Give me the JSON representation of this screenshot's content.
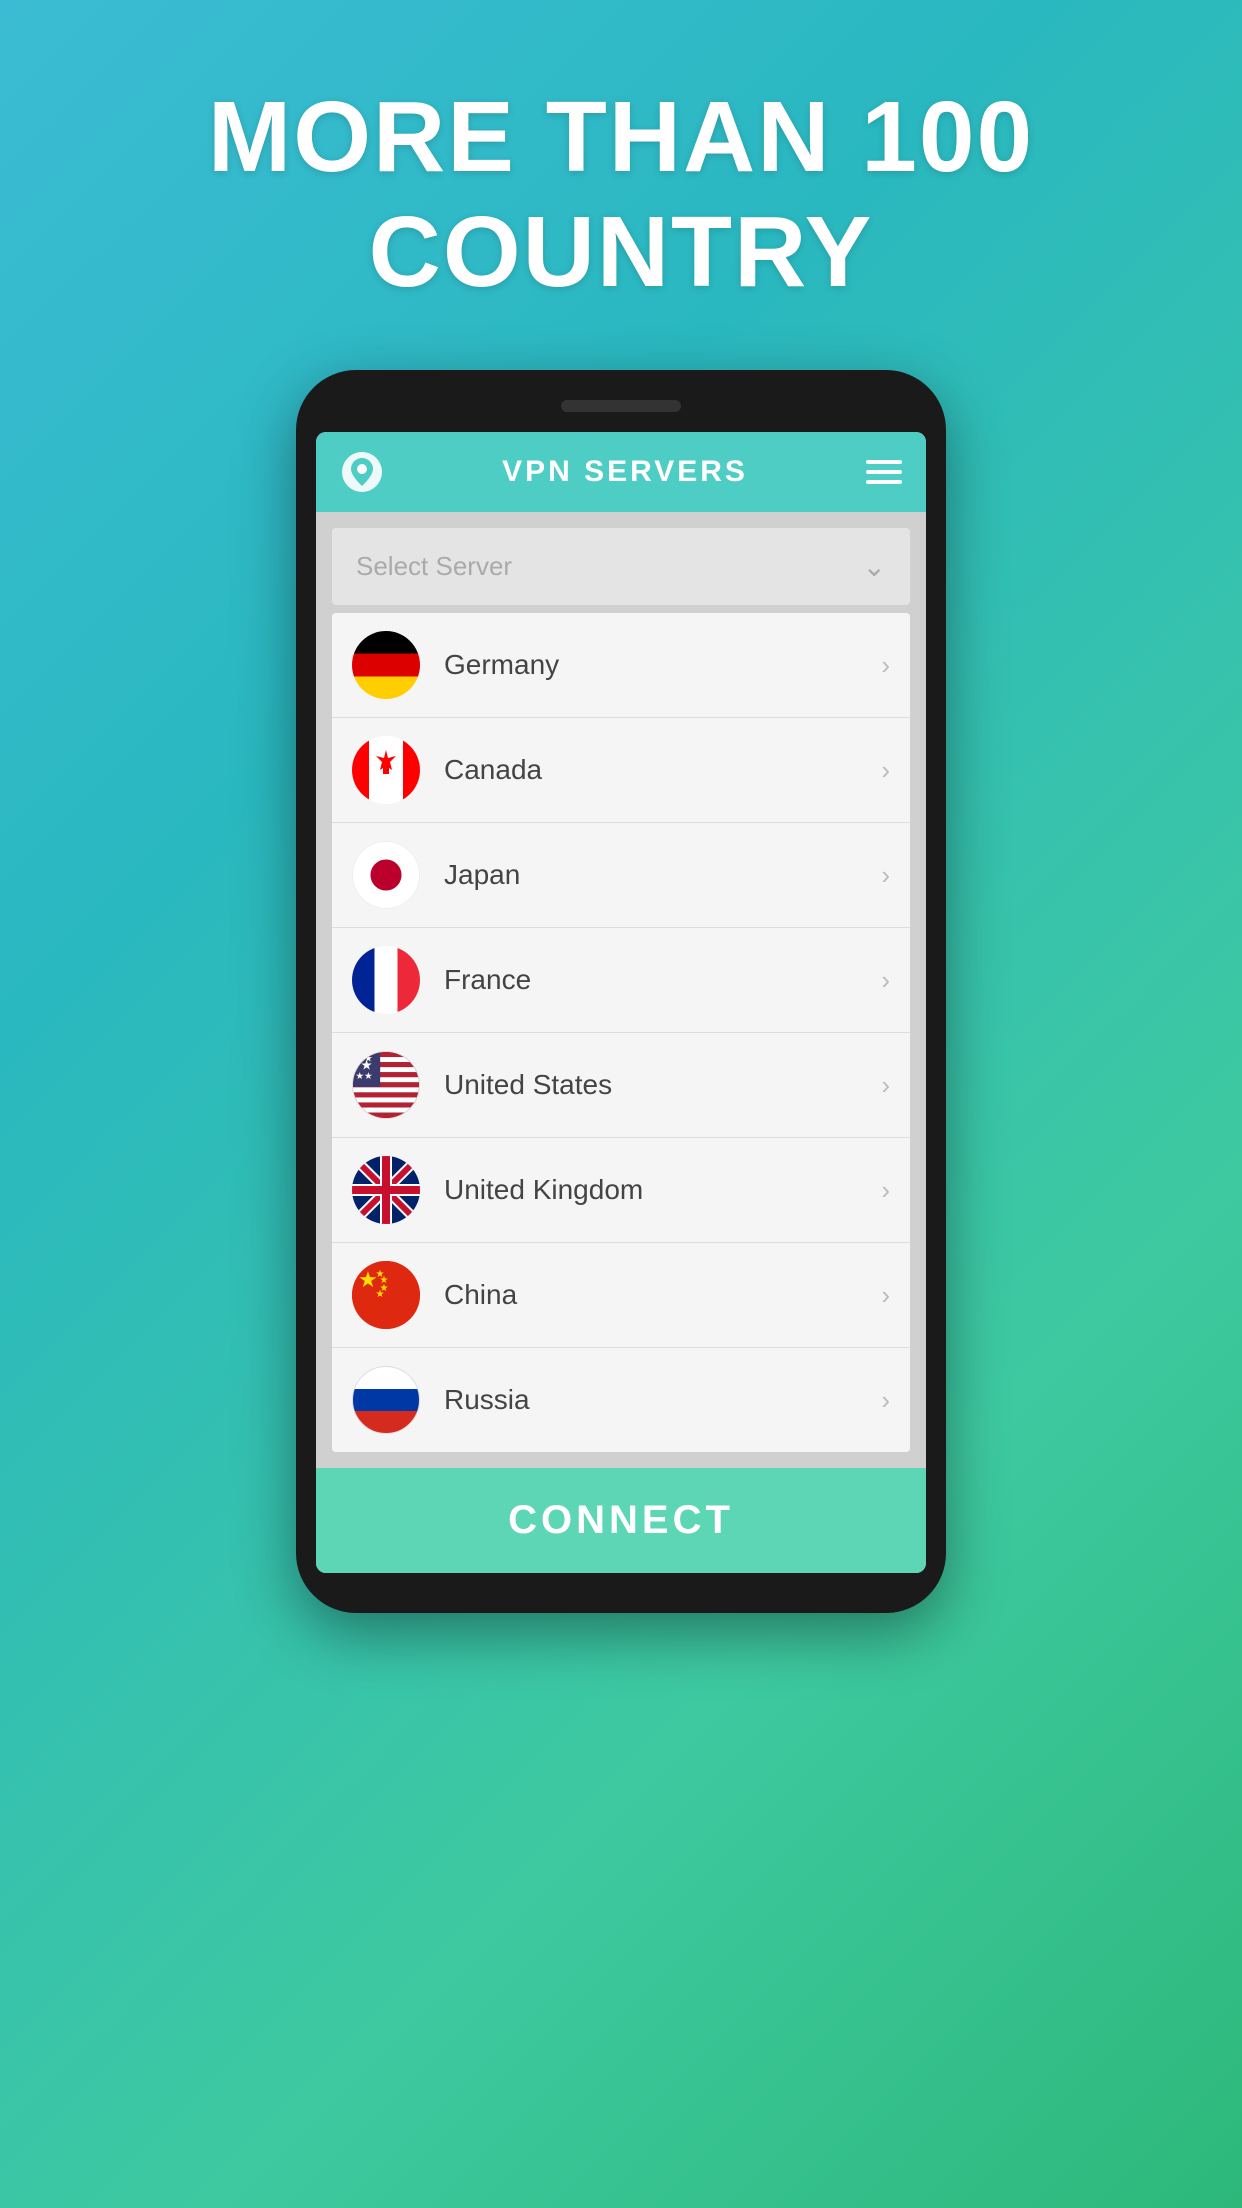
{
  "headline": {
    "line1": "MORE THAN 100",
    "line2": "COUNTRY"
  },
  "header": {
    "title": "VPN SERVERS",
    "icon_name": "location-pin-icon",
    "menu_icon_name": "hamburger-menu-icon"
  },
  "select_server": {
    "placeholder": "Select Server",
    "chevron": "❯"
  },
  "countries": [
    {
      "name": "Germany",
      "flag_type": "germany"
    },
    {
      "name": "Canada",
      "flag_type": "canada"
    },
    {
      "name": "Japan",
      "flag_type": "japan"
    },
    {
      "name": "France",
      "flag_type": "france"
    },
    {
      "name": "United States",
      "flag_type": "us"
    },
    {
      "name": "United Kingdom",
      "flag_type": "uk"
    },
    {
      "name": "China",
      "flag_type": "china"
    },
    {
      "name": "Russia",
      "flag_type": "russia"
    }
  ],
  "connect_button": {
    "label": "CONNECT"
  },
  "colors": {
    "header_bg": "#4ecdc4",
    "connect_bg": "#5dd6b5",
    "background_gradient_start": "#3bbcd4",
    "background_gradient_end": "#2db87a"
  }
}
